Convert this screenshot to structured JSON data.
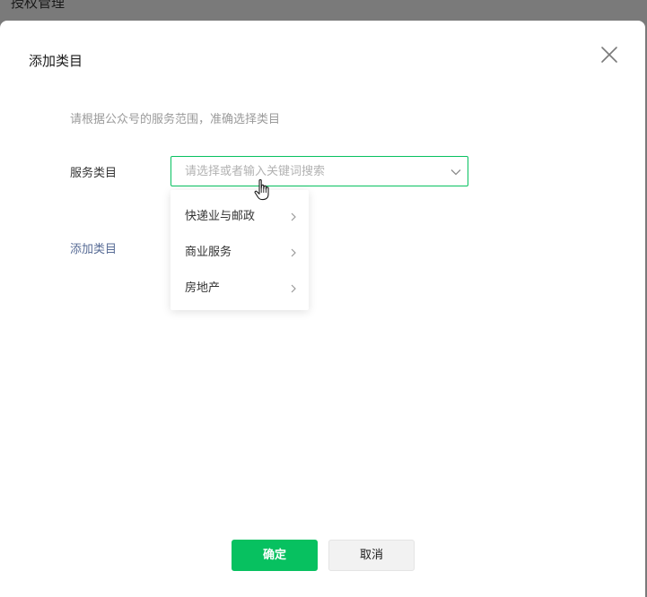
{
  "background": {
    "page_title": "授权管理"
  },
  "dialog": {
    "title": "添加类目",
    "close_icon": "close-icon",
    "tip": "请根据公众号的服务范围，准确选择类目",
    "field_label": "服务类目",
    "select": {
      "placeholder": "请选择或者输入关键词搜索",
      "value": "",
      "arrow_icon": "chevron-down-icon"
    },
    "dropdown": {
      "items": [
        {
          "label": "快递业与邮政"
        },
        {
          "label": "商业服务"
        },
        {
          "label": "房地产"
        }
      ]
    },
    "add_link": "添加类目",
    "buttons": {
      "confirm": "确定",
      "cancel": "取消"
    }
  },
  "colors": {
    "accent": "#07c160",
    "link": "#576b95",
    "muted_text": "#9a9a9a"
  }
}
